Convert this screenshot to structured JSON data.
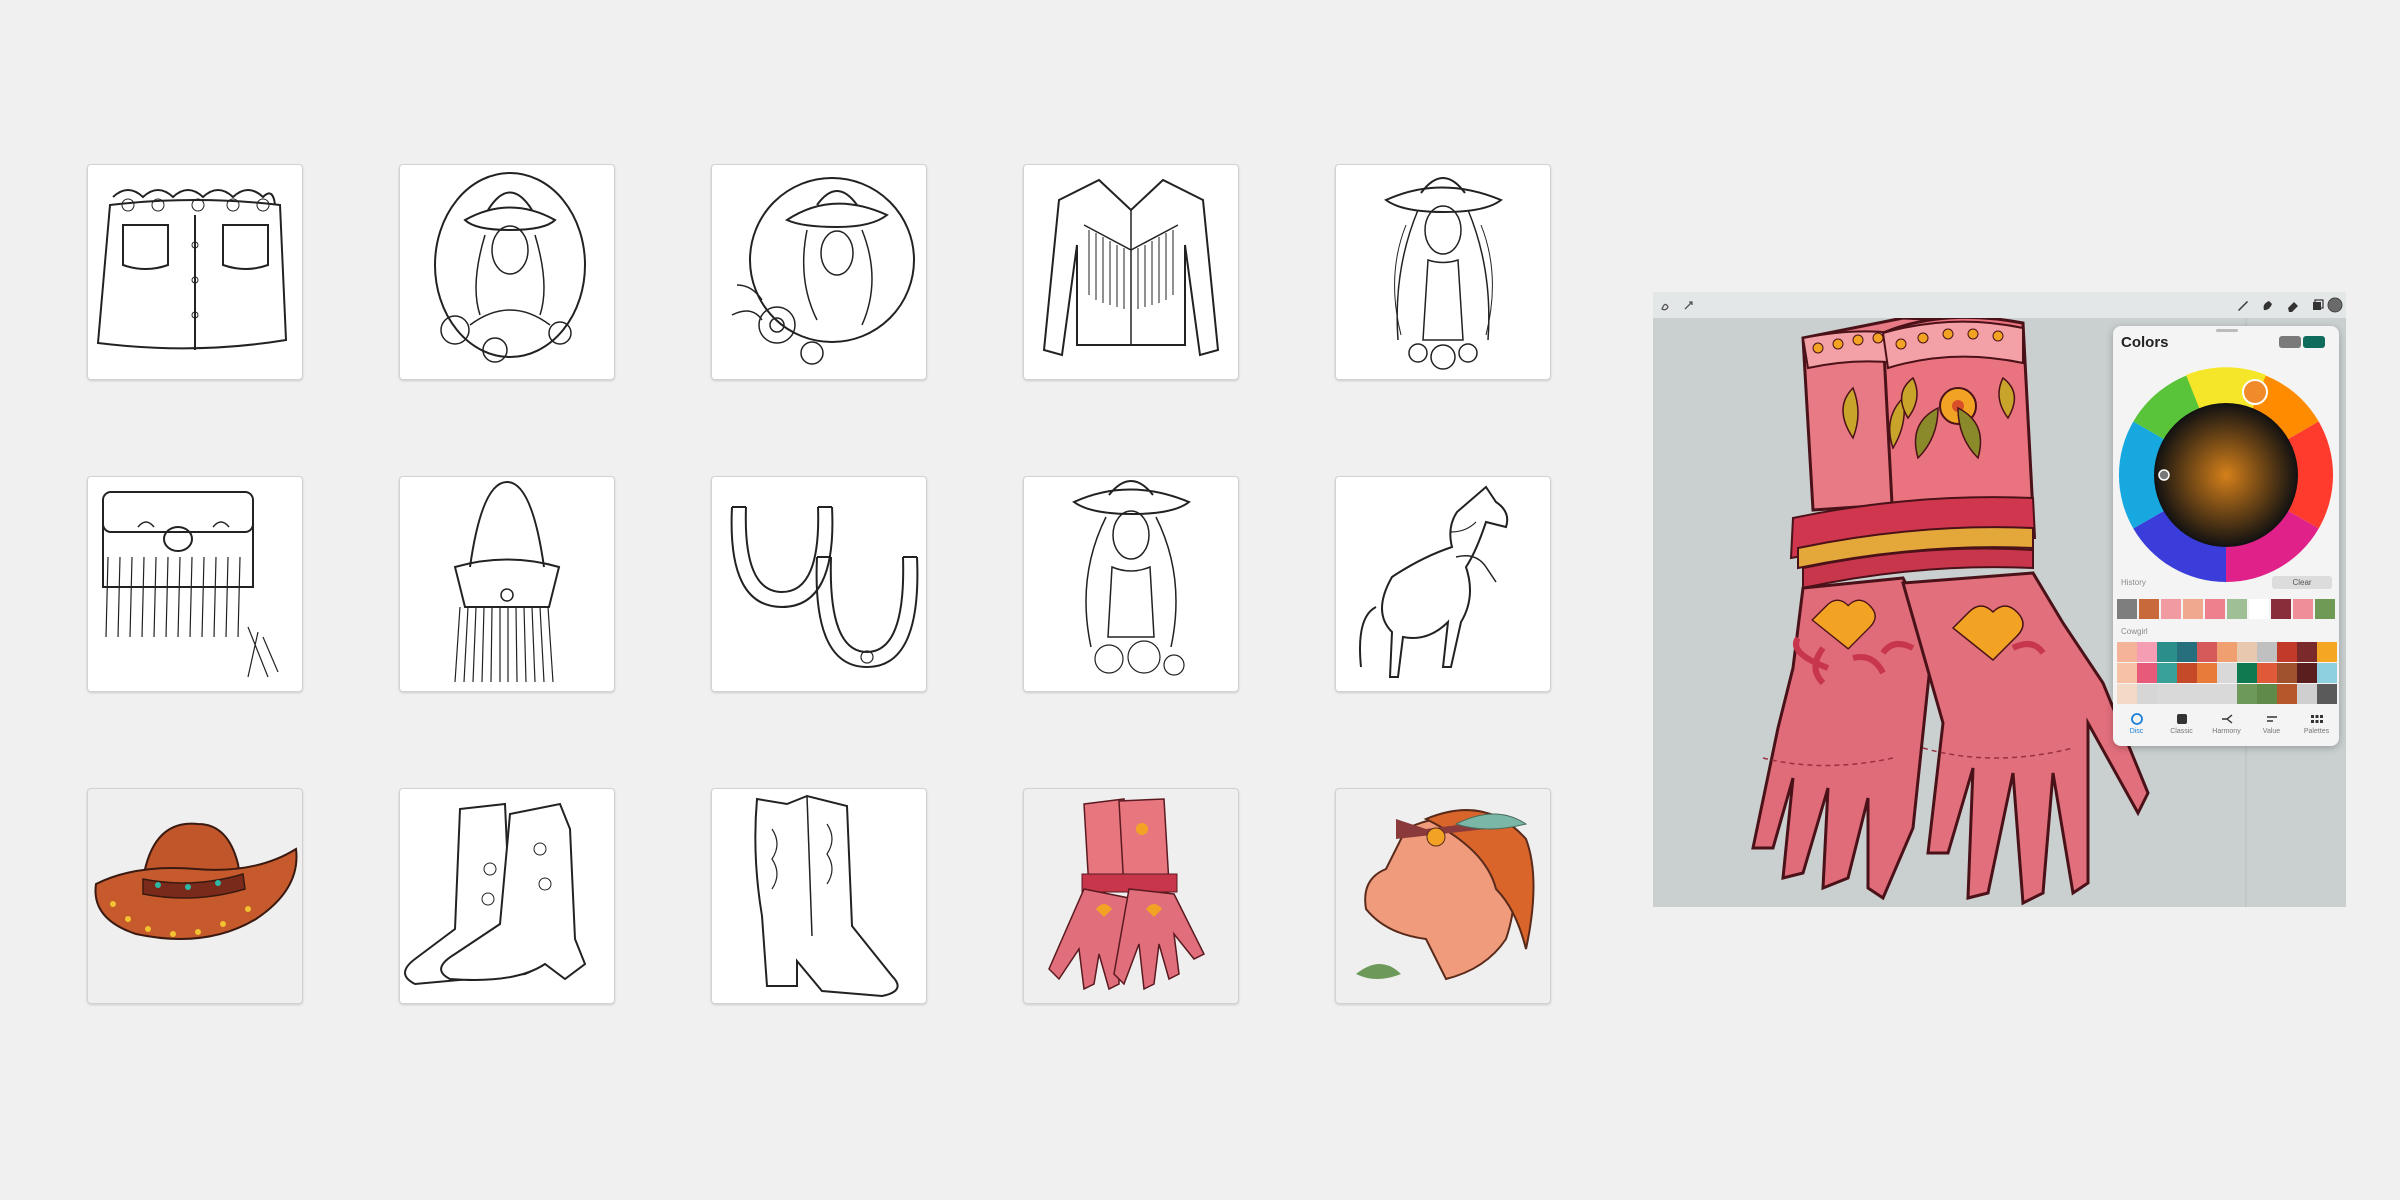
{
  "gallery": {
    "rows": [
      [
        "skirt",
        "cowgirl-portrait-oval",
        "cowgirl-portrait-circle",
        "fringe-jacket",
        "cowgirl-long-hair"
      ],
      [
        "fringe-bag",
        "fringe-purse",
        "horseshoes",
        "cowgirl-flowers",
        "rearing-horse"
      ],
      [
        "cowboy-hat-colored",
        "cowboy-boots-pair",
        "cowboy-boot-tall",
        "gloves-colored",
        "horse-head-colored"
      ]
    ]
  },
  "app": {
    "toolbar_icons": [
      "gallery-icon",
      "actions-icon",
      "brush-icon",
      "smudge-icon",
      "eraser-icon",
      "layers-icon",
      "color-icon"
    ],
    "colors_panel": {
      "title": "Colors",
      "current_colors": [
        "#7a7a7a",
        "#0f6b5c"
      ],
      "history_label": "History",
      "clear_label": "Clear",
      "history": [
        "#7e7e7e",
        "#c8693c",
        "#f19aa2",
        "#f0a88e",
        "#ee7f8c",
        "#9fbf97",
        "#ffffff",
        "#8a2d3a",
        "#ef8e99",
        "#6e9a56"
      ],
      "palette_label": "Cowgirl",
      "palette": [
        [
          "#f5b49a",
          "#f59db2",
          "#2a8e8a",
          "#286f7e",
          "#d65a5a",
          "#f0a070",
          "#e8c9b0",
          "#c0c0c0",
          "#c23b2a",
          "#7a2a2a",
          "#f5a623"
        ],
        [
          "#f7c1a6",
          "#e85a7a",
          "#3aa198",
          "#c44a2a",
          "#e87a3a",
          "#d9d9d9",
          "#0f7a50",
          "#e05a3a",
          "#a0522d",
          "#5a1e1e",
          "#8fd0e0"
        ],
        [
          "#f4d9c6",
          "#d6d6d6",
          "#d9d9d9",
          "#d9d9d9",
          "#d9d9d9",
          "#d9d9d9",
          "#6d9a5a",
          "#5f8a4a",
          "#b5562b",
          "#cfcfcf",
          "#5a5a5a"
        ]
      ],
      "tabs": [
        {
          "label": "Disc",
          "icon": "disc-icon",
          "active": true
        },
        {
          "label": "Classic",
          "icon": "classic-icon",
          "active": false
        },
        {
          "label": "Harmony",
          "icon": "harmony-icon",
          "active": false
        },
        {
          "label": "Value",
          "icon": "value-icon",
          "active": false
        },
        {
          "label": "Palettes",
          "icon": "palettes-icon",
          "active": false
        }
      ]
    }
  }
}
